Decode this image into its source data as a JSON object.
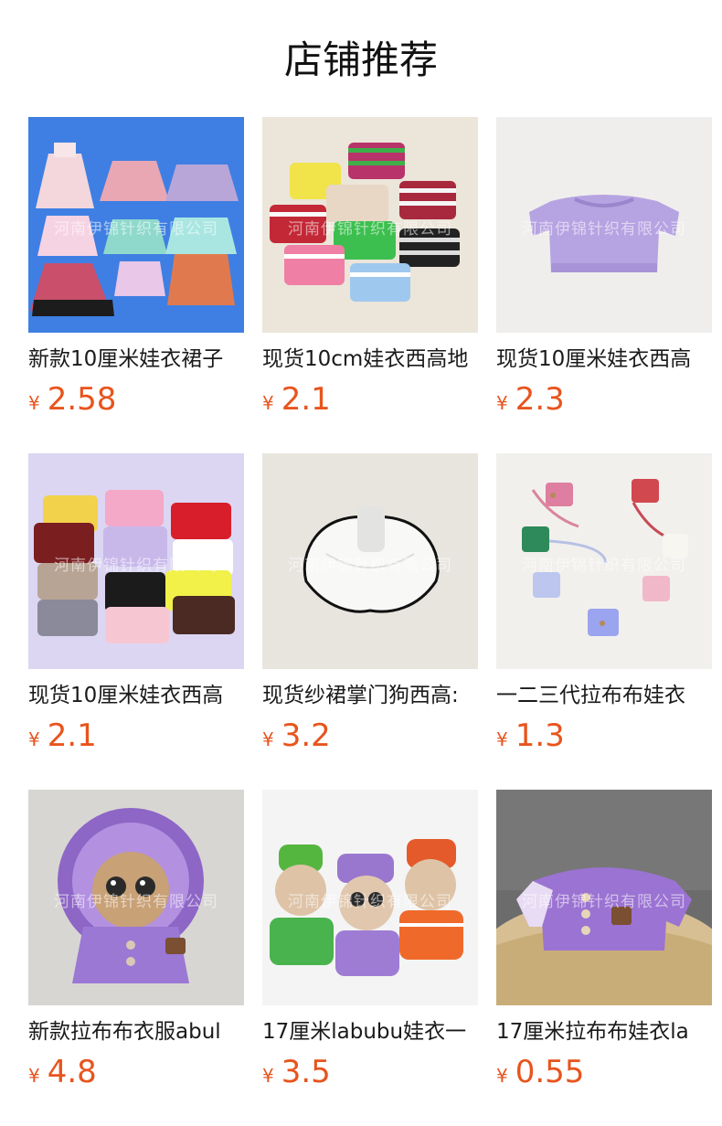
{
  "header": {
    "title": "店铺推荐"
  },
  "colors": {
    "price": "#e8541d",
    "title": "#111111"
  },
  "watermark_text": "河南伊锦针织有限公司",
  "products": [
    {
      "title": "新款10厘米娃衣裙子",
      "currency": "¥",
      "price": "2.58",
      "image": "doll-dresses-photo",
      "bg": "#4a86e8"
    },
    {
      "title": "现货10cm娃衣西高地",
      "currency": "¥",
      "price": "2.1",
      "image": "striped-sweaters-photo",
      "bg": "#efe9df"
    },
    {
      "title": "现货10厘米娃衣西高",
      "currency": "¥",
      "price": "2.3",
      "image": "lavender-top-photo",
      "bg": "#f2f0ee"
    },
    {
      "title": "现货10厘米娃衣西高",
      "currency": "¥",
      "price": "2.1",
      "image": "colored-sweaters-photo",
      "bg": "#dcd6f2"
    },
    {
      "title": "现货纱裙掌门狗西高:",
      "currency": "¥",
      "price": "3.2",
      "image": "white-tutu-photo",
      "bg": "#e9e6e1"
    },
    {
      "title": "一二三代拉布布娃衣",
      "currency": "¥",
      "price": "1.3",
      "image": "knit-bags-photo",
      "bg": "#f3f1ee"
    },
    {
      "title": "新款拉布布衣服abul",
      "currency": "¥",
      "price": "4.8",
      "image": "purple-hood-doll-photo",
      "bg": "#d9d7d4"
    },
    {
      "title": "17厘米labubu娃衣一",
      "currency": "¥",
      "price": "3.5",
      "image": "three-dolls-photo",
      "bg": "#f4f4f4"
    },
    {
      "title": "17厘米拉布布娃衣la",
      "currency": "¥",
      "price": "0.55",
      "image": "purple-sweater-basket-photo",
      "bg": "#6e6e6e"
    }
  ]
}
